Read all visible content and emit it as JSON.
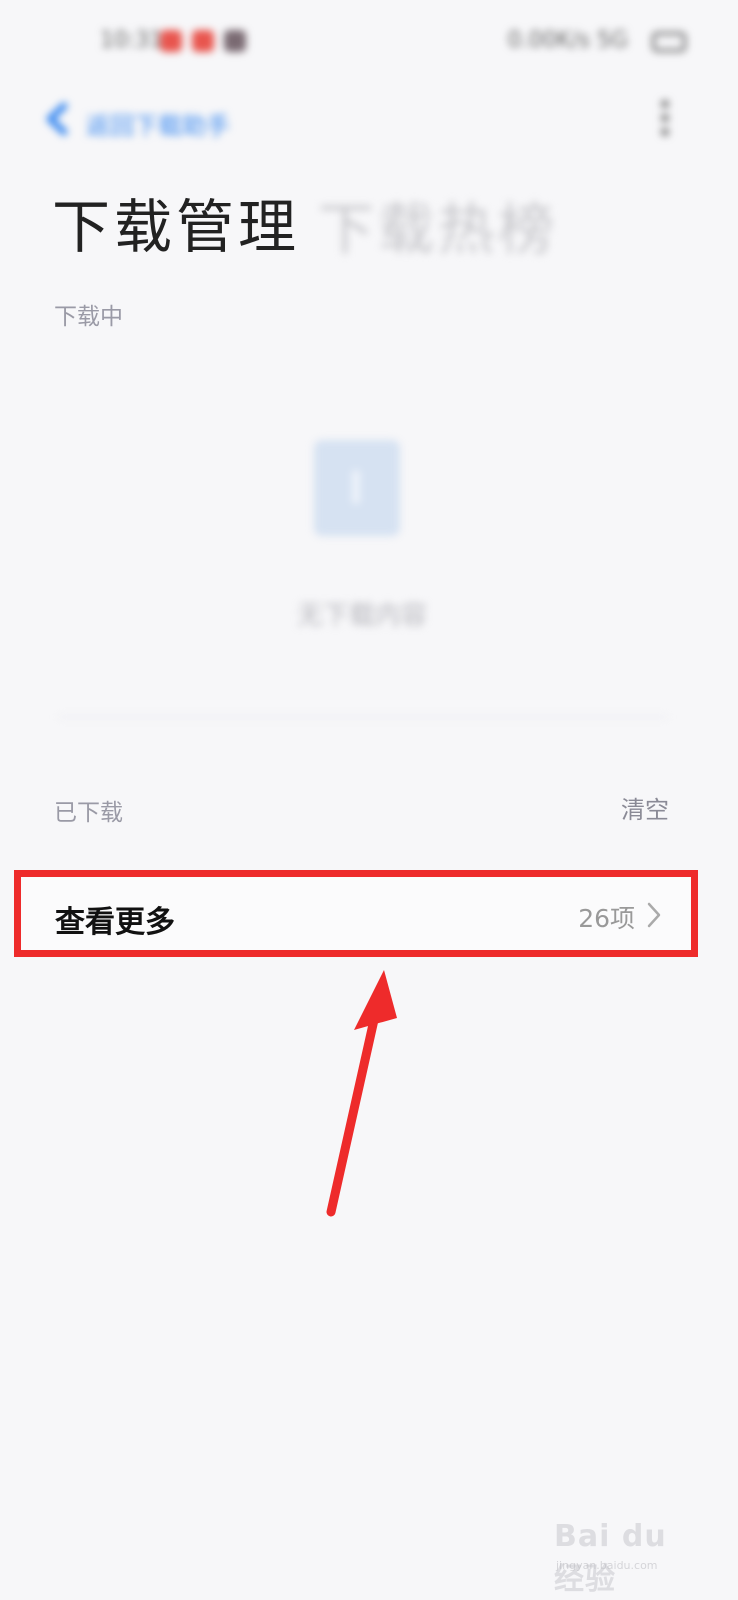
{
  "status_bar": {
    "time": "10:31",
    "indicators": "0.00K/s  5G",
    "dot_colors": [
      "#e8554e",
      "#e8554e",
      "#7a6a72"
    ]
  },
  "top_nav": {
    "back_label": "返回下载助手",
    "accent_color": "#3d8bf0"
  },
  "tabs": [
    {
      "label": "下载管理",
      "active": true
    },
    {
      "label": "下载热榜",
      "active": false
    }
  ],
  "downloading": {
    "section_label": "下载中",
    "empty_text": "无下载内容"
  },
  "downloaded": {
    "section_label": "已下载",
    "clear_label": "清空"
  },
  "view_more": {
    "label": "查看更多",
    "count": "26项",
    "highlight_color": "#ee2b2b"
  },
  "watermark": {
    "text": "Bai du 经验",
    "sub": "jingyan.baidu.com"
  }
}
